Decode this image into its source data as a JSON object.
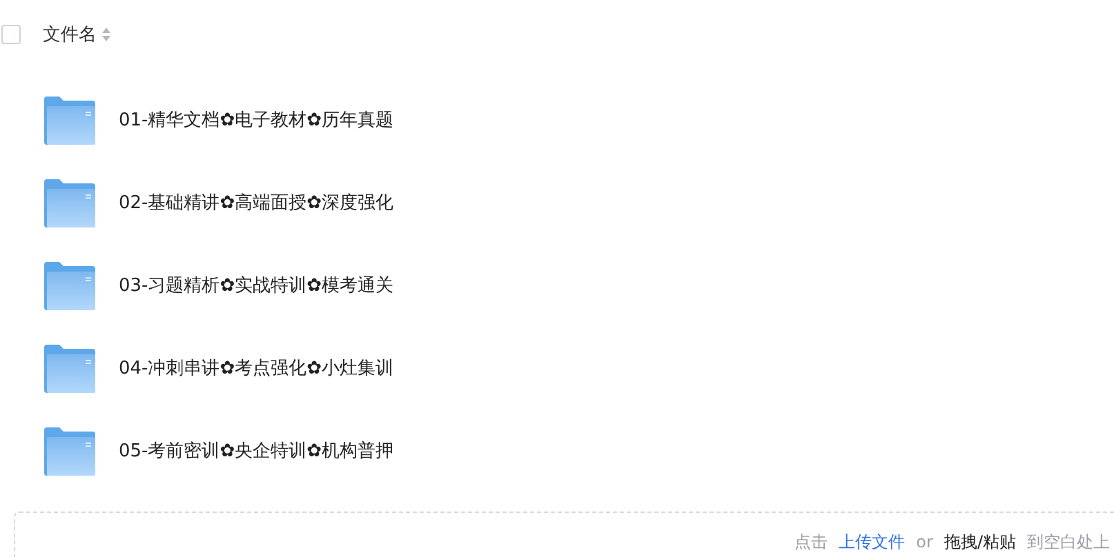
{
  "header": {
    "checked": false,
    "column": "文件名"
  },
  "files": [
    {
      "name": "01-精华文档✿电子教材✿历年真题"
    },
    {
      "name": "02-基础精讲✿高端面授✿深度强化"
    },
    {
      "name": "03-习题精析✿实战特训✿模考通关"
    },
    {
      "name": "04-冲刺串讲✿考点强化✿小灶集训"
    },
    {
      "name": "05-考前密训✿央企特训✿机构普押"
    }
  ],
  "upload": {
    "prefix": "点击",
    "link": "上传文件",
    "or": "or",
    "action": "拖拽/粘贴",
    "suffix": "到空白处上"
  }
}
